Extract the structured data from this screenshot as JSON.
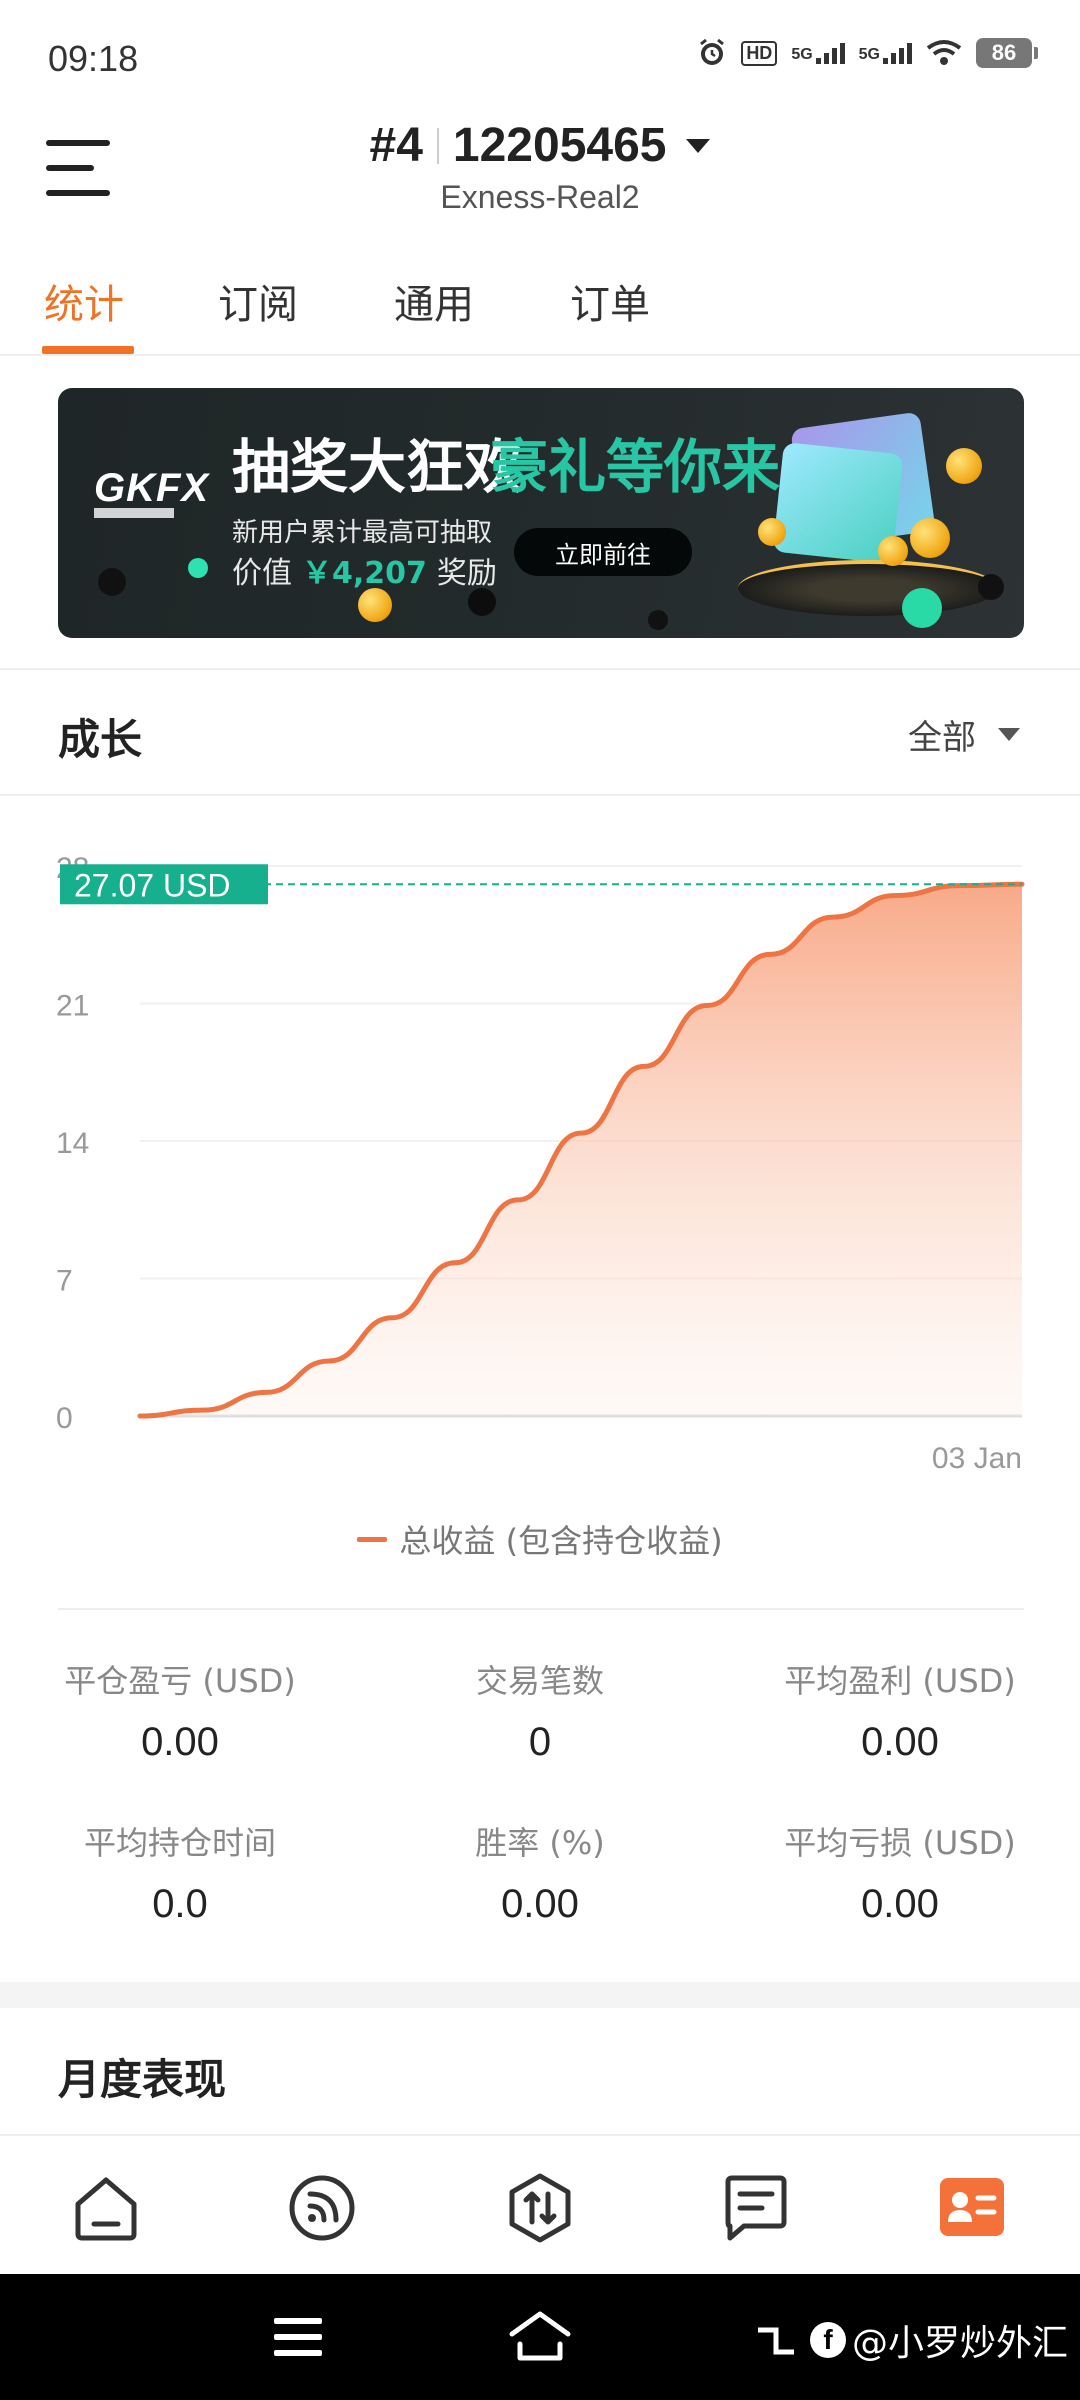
{
  "status_bar": {
    "time": "09:18",
    "hd_label": "HD",
    "net1": "5G",
    "net2": "5G",
    "battery": "86"
  },
  "header": {
    "account_index": "#4",
    "account_number": "12205465",
    "server": "Exness-Real2"
  },
  "tabs": [
    {
      "label": "统计",
      "active": true
    },
    {
      "label": "订阅",
      "active": false
    },
    {
      "label": "通用",
      "active": false
    },
    {
      "label": "订单",
      "active": false
    }
  ],
  "banner": {
    "brand": "GKFX",
    "title_white": "抽奖大狂欢",
    "title_green": "豪礼等你来",
    "line1": "新用户累计最高可抽取",
    "line2_prefix": "价值",
    "line2_amount": "￥4,207",
    "line2_suffix": "奖励",
    "cta": "立即前往"
  },
  "growth": {
    "title": "成长",
    "filter": "全部",
    "current_value_label": "27.07 USD"
  },
  "chart_data": {
    "type": "area",
    "x": [
      "start",
      "03 Jan"
    ],
    "x_tick_labels": [
      "03 Jan"
    ],
    "y_tick_labels": [
      "0",
      "7",
      "14",
      "21",
      "28"
    ],
    "ylim": [
      0,
      28
    ],
    "series": [
      {
        "name": "总收益 (包含持仓收益)",
        "color": "#ef7444",
        "values": [
          0,
          0.3,
          1.2,
          2.8,
          5.0,
          7.8,
          11.0,
          14.4,
          17.8,
          20.9,
          23.5,
          25.4,
          26.5,
          27.0,
          27.07
        ]
      }
    ],
    "current_value": 27.07,
    "current_value_unit": "USD",
    "grid": true
  },
  "legend": {
    "label": "总收益 (包含持仓收益)"
  },
  "stats": [
    {
      "label": "平仓盈亏 (USD)",
      "value": "0.00"
    },
    {
      "label": "交易笔数",
      "value": "0"
    },
    {
      "label": "平均盈利 (USD)",
      "value": "0.00"
    },
    {
      "label": "平均持仓时间",
      "value": "0.0"
    },
    {
      "label": "胜率 (%)",
      "value": "0.00"
    },
    {
      "label": "平均亏损 (USD)",
      "value": "0.00"
    }
  ],
  "monthly": {
    "title": "月度表现"
  },
  "bottom_nav": [
    {
      "icon": "home-icon",
      "active": false
    },
    {
      "icon": "signal-icon",
      "active": false
    },
    {
      "icon": "trade-icon",
      "active": false
    },
    {
      "icon": "message-icon",
      "active": false
    },
    {
      "icon": "profile-icon",
      "active": true
    }
  ],
  "colors": {
    "accent": "#f07325",
    "chart_line": "#ef7444",
    "highlight_green": "#17b08f"
  },
  "watermark": "@小罗炒外汇"
}
